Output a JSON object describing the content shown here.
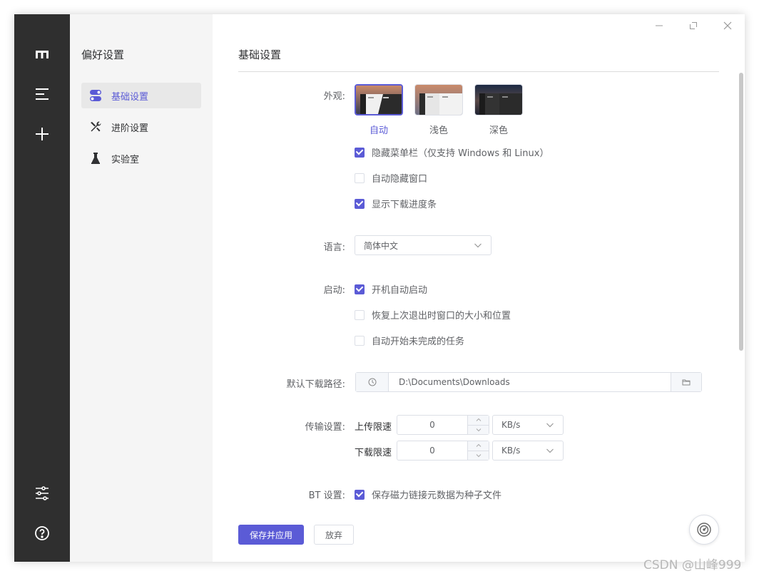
{
  "window": {
    "controls": [
      "minimize-icon",
      "restore-icon",
      "close-icon"
    ]
  },
  "rail": {
    "icons": [
      "logo-icon",
      "menu-icon",
      "plus-icon",
      "sliders-icon",
      "help-icon"
    ]
  },
  "subnav": {
    "title": "偏好设置",
    "items": [
      {
        "label": "基础设置",
        "icon": "toggle-icon",
        "active": true
      },
      {
        "label": "进阶设置",
        "icon": "wrench-icon",
        "active": false
      },
      {
        "label": "实验室",
        "icon": "flask-icon",
        "active": false
      }
    ]
  },
  "main": {
    "title": "基础设置",
    "appearance": {
      "label": "外观:",
      "options": [
        {
          "label": "自动",
          "selected": true
        },
        {
          "label": "浅色",
          "selected": false
        },
        {
          "label": "深色",
          "selected": false
        }
      ],
      "checks": [
        {
          "label": "隐藏菜单栏（仅支持 Windows 和 Linux）",
          "checked": true
        },
        {
          "label": "自动隐藏窗口",
          "checked": false
        },
        {
          "label": "显示下载进度条",
          "checked": true
        }
      ]
    },
    "language": {
      "label": "语言:",
      "value": "简体中文"
    },
    "startup": {
      "label": "启动:",
      "checks": [
        {
          "label": "开机自动启动",
          "checked": true
        },
        {
          "label": "恢复上次退出时窗口的大小和位置",
          "checked": false
        },
        {
          "label": "自动开始未完成的任务",
          "checked": false
        }
      ]
    },
    "download_path": {
      "label": "默认下载路径:",
      "value": "D:\\Documents\\Downloads"
    },
    "transfer": {
      "label": "传输设置:",
      "upload_label": "上传限速",
      "upload_value": "0",
      "upload_unit": "KB/s",
      "download_label": "下载限速",
      "download_value": "0",
      "download_unit": "KB/s"
    },
    "bt": {
      "label": "BT 设置:",
      "check": {
        "label": "保存磁力链接元数据为种子文件",
        "checked": true
      }
    },
    "buttons": {
      "save": "保存并应用",
      "discard": "放弃"
    }
  },
  "watermark": "CSDN @山峰999",
  "colors": {
    "accent": "#5b5bd6",
    "rail_bg": "#2f2f2f",
    "subnav_bg": "#f5f5f5"
  }
}
